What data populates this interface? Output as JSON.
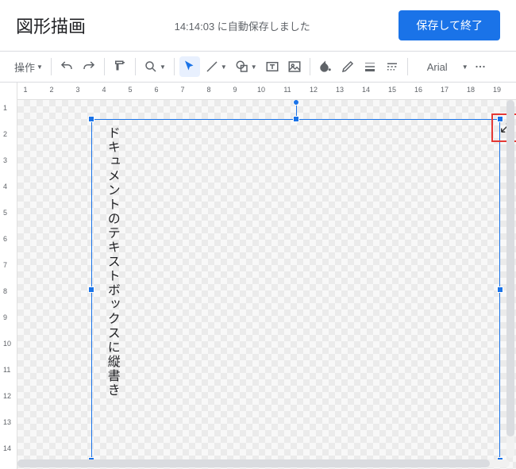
{
  "header": {
    "title": "図形描画",
    "status": "14:14:03 に自動保存しました",
    "save_close": "保存して終了"
  },
  "toolbar": {
    "ops": "操作",
    "font": "Arial"
  },
  "ruler_h": [
    1,
    2,
    3,
    4,
    5,
    6,
    7,
    8,
    9,
    10,
    11,
    12,
    13,
    14,
    15,
    16,
    17,
    18,
    19
  ],
  "ruler_v": [
    1,
    2,
    3,
    4,
    5,
    6,
    7,
    8,
    9,
    10,
    11,
    12,
    13,
    14
  ],
  "textbox": {
    "content": "ドキュメントのテキストボックスに縦書き"
  }
}
